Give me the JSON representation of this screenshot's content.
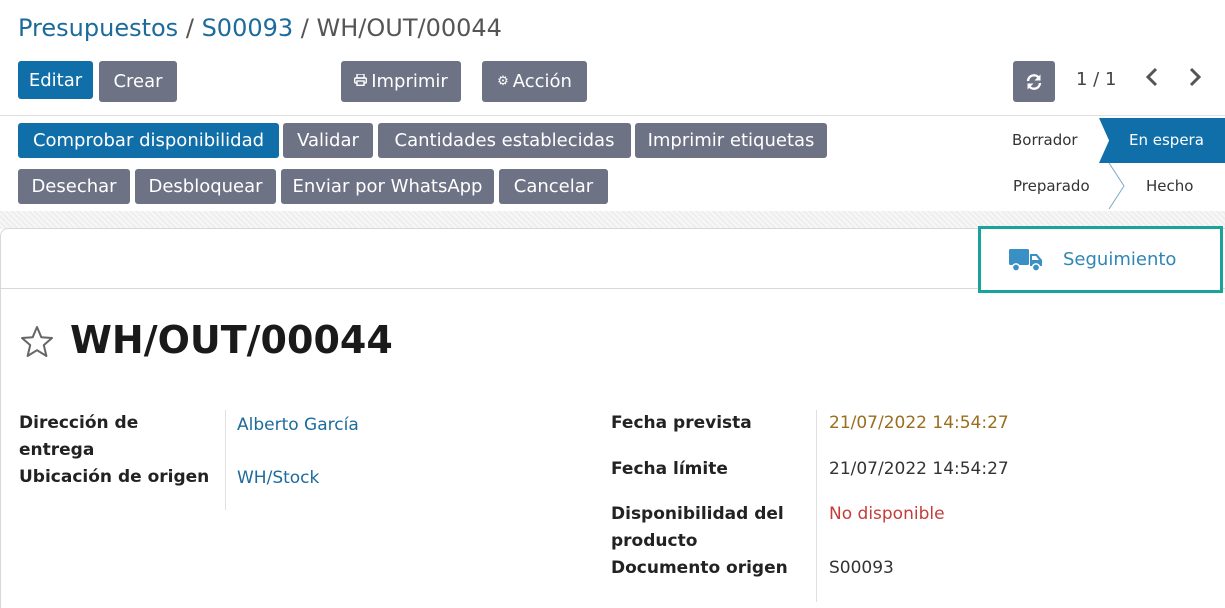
{
  "breadcrumb": {
    "items": [
      "Presupuestos",
      "S00093"
    ],
    "separator": "/",
    "current": "WH/OUT/00044"
  },
  "toolbar": {
    "edit_label": "Editar",
    "create_label": "Crear",
    "print_label": "Imprimir",
    "action_label": "Acción",
    "pager": "1 / 1"
  },
  "actions": {
    "check_availability": "Comprobar disponibilidad",
    "validate": "Validar",
    "set_quantities": "Cantidades establecidas",
    "print_labels": "Imprimir etiquetas",
    "scrap": "Desechar",
    "unlock": "Desbloquear",
    "whatsapp": "Enviar por WhatsApp",
    "cancel": "Cancelar"
  },
  "statusbar": {
    "draft": "Borrador",
    "waiting": "En espera",
    "ready": "Preparado",
    "done": "Hecho",
    "active": "En espera"
  },
  "buttonbox": {
    "tracking_label": "Seguimiento",
    "tracking_icon": "truck-icon"
  },
  "record": {
    "name": "WH/OUT/00044",
    "favorite_icon": "star-icon"
  },
  "fields": {
    "delivery_address_label_1": "Dirección de",
    "delivery_address_label_2": "entrega",
    "delivery_address_value": "Alberto García",
    "source_location_label": "Ubicación de origen",
    "source_location_value": "WH/Stock",
    "scheduled_date_label": "Fecha prevista",
    "scheduled_date_value": "21/07/2022 14:54:27",
    "deadline_label": "Fecha límite",
    "deadline_value": "21/07/2022 14:54:27",
    "availability_label_1": "Disponibilidad del",
    "availability_label_2": "producto",
    "availability_value": "No disponible",
    "origin_label": "Documento origen",
    "origin_value": "S00093"
  },
  "colors": {
    "primary": "#106fa8",
    "secondary": "#6d7285",
    "scheduled_date": "#9a6d1f",
    "not_available": "#c53b3b",
    "highlight_border": "#1aa39a"
  }
}
